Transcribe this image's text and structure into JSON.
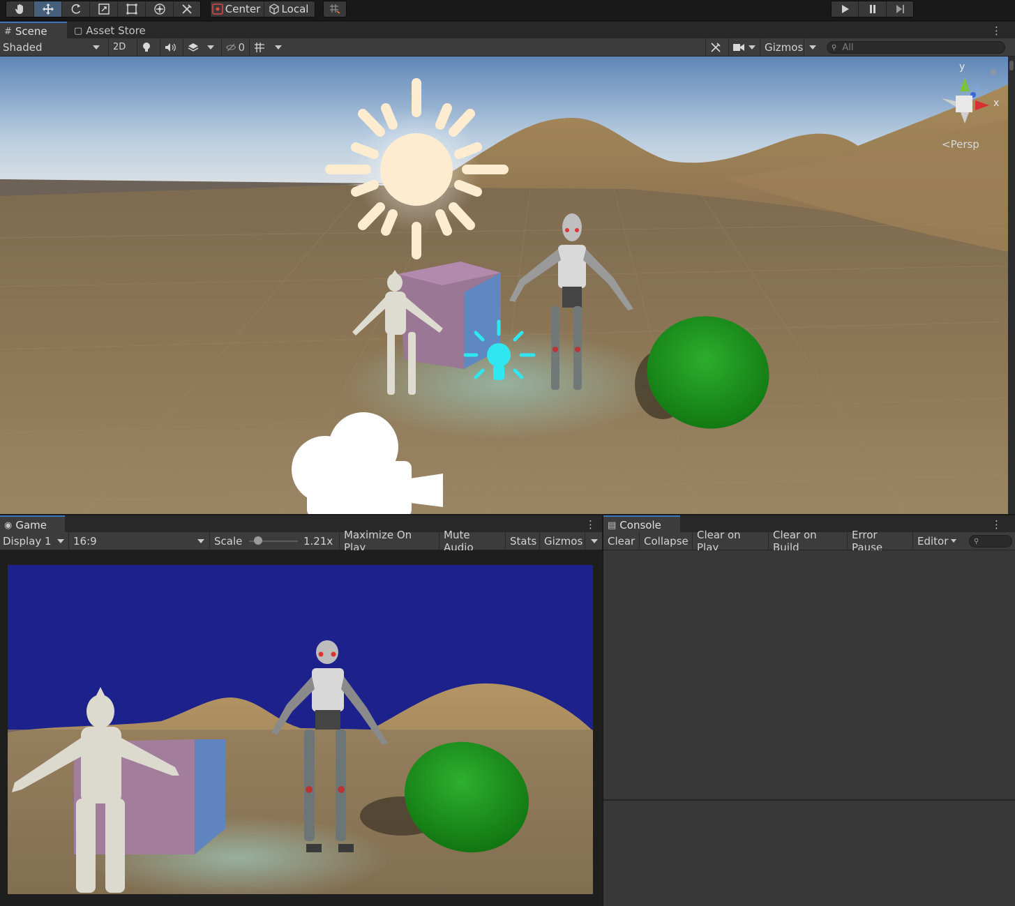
{
  "toolbar": {
    "tools": [
      "hand-tool",
      "move-tool",
      "rotate-tool",
      "scale-tool",
      "rect-tool",
      "transform-tool",
      "custom-tool"
    ],
    "pivot_mode": "Center",
    "pivot_rotation": "Local",
    "active_tool": "move-tool",
    "playback": [
      "play",
      "pause",
      "step"
    ]
  },
  "scene_panel": {
    "tabs": [
      {
        "label": "Scene",
        "icon": "grid-icon",
        "active": true
      },
      {
        "label": "Asset Store",
        "icon": "bag-icon",
        "active": false
      }
    ],
    "shading_mode": "Shaded",
    "mode_2d": "2D",
    "hidden_count": "0",
    "gizmos_label": "Gizmos",
    "search_placeholder": "All",
    "projection": "Persp",
    "axes": {
      "x": "x",
      "y": "y",
      "z": "z"
    }
  },
  "game_panel": {
    "tab": {
      "label": "Game",
      "icon": "gamepad-icon"
    },
    "display": "Display 1",
    "aspect": "16:9",
    "scale_label": "Scale",
    "scale_value": "1.21x",
    "maximize_on_play": "Maximize On Play",
    "mute_audio": "Mute Audio",
    "stats": "Stats",
    "gizmos": "Gizmos"
  },
  "console_panel": {
    "tab": {
      "label": "Console",
      "icon": "console-icon"
    },
    "buttons": {
      "clear": "Clear",
      "collapse": "Collapse",
      "clear_on_play": "Clear on Play",
      "clear_on_build": "Clear on Build",
      "error_pause": "Error Pause",
      "editor": "Editor"
    }
  },
  "colors": {
    "accent": "#3a79bb",
    "active_tool": "#46607c",
    "game_sky": "#1c218c",
    "sand": "#a8895f",
    "sphere": "#1f9a1f",
    "light_gizmo": "#30e6f0"
  }
}
